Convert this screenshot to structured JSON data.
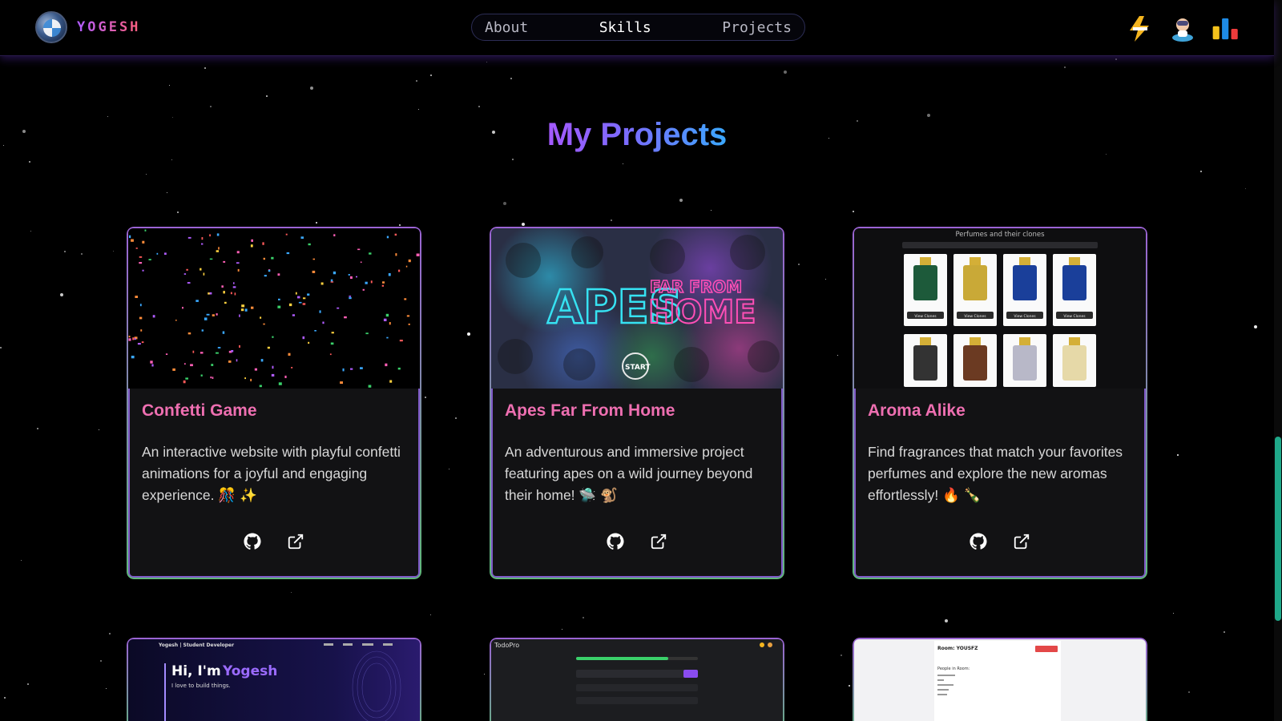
{
  "header": {
    "logo_text": "YOGESH",
    "nav": [
      "About",
      "Skills",
      "Projects"
    ],
    "active_nav": "Skills",
    "icons": [
      "lightning-toggle-icon",
      "astronaut-icon",
      "bar-chart-icon"
    ]
  },
  "section": {
    "title": "My Projects"
  },
  "projects": [
    {
      "title": "Confetti Game",
      "description": "An interactive website with playful confetti animations for a joyful and engaging experience. 🎊 ✨",
      "thumbnail": "confetti-preview"
    },
    {
      "title": "Apes Far From Home",
      "description": "An adventurous and immersive project featuring apes on a wild journey beyond their home! 🛸 🐒",
      "thumbnail": "apes-preview",
      "thumb_text": {
        "main": "APES",
        "sub": "FAR FROM",
        "sub2": "HOME",
        "start": "START"
      }
    },
    {
      "title": "Aroma Alike",
      "description": "Find fragrances that match your favorites perfumes and explore the new aromas effortlessly! 🔥 🍾",
      "thumbnail": "aroma-preview",
      "thumb_text": {
        "heading": "Perfumes and their clones",
        "button": "View Clones"
      }
    }
  ],
  "more_projects": [
    {
      "thumbnail": "portfolio-preview",
      "thumb_text": {
        "nav": "Yogesh | Student Developer",
        "hi": "Hi, I'm",
        "name": "Yogesh",
        "tagline": "I love to build things."
      }
    },
    {
      "thumbnail": "todopro-preview",
      "thumb_text": {
        "brand": "TodoPro"
      }
    },
    {
      "thumbnail": "room-preview",
      "thumb_text": {
        "room": "Room: YOUSFZ",
        "people": "People in Room:"
      }
    }
  ],
  "colors": {
    "accent_purple": "#a559ff",
    "accent_blue": "#3aa8ff",
    "card_title": "#ee6fb1",
    "scroll_thumb": "#1fa889"
  }
}
